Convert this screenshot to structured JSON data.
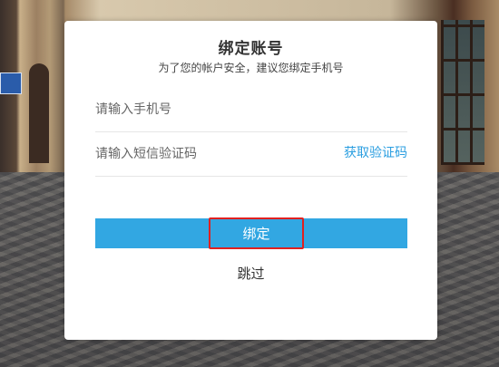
{
  "dialog": {
    "title": "绑定账号",
    "subtitle": "为了您的帐户安全，建议您绑定手机号",
    "phone_input": {
      "placeholder": "请输入手机号",
      "value": ""
    },
    "code_input": {
      "placeholder": "请输入短信验证码",
      "value": ""
    },
    "get_code_label": "获取验证码",
    "bind_label": "绑定",
    "skip_label": "跳过"
  },
  "colors": {
    "accent": "#32a7e2",
    "link": "#2a9ee0",
    "highlight_border": "#e02020"
  }
}
